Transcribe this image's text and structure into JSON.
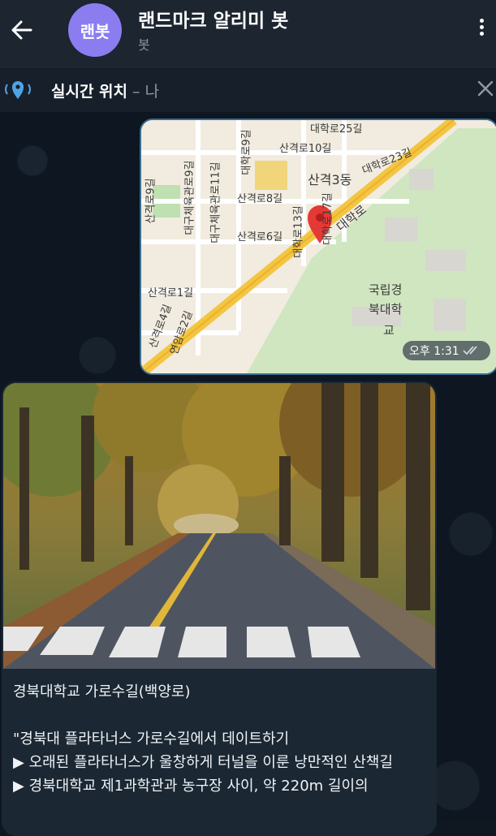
{
  "header": {
    "avatar_text": "랜봇",
    "title": "랜드마크 알리미 봇",
    "subtitle": "봇"
  },
  "live_location": {
    "label": "실시간 위치",
    "who": " – 나"
  },
  "map_message": {
    "time": "오후 1:31",
    "labels": [
      "대학로25길",
      "산격로10길",
      "산격3동",
      "대학로23길",
      "산격로9길",
      "대구체육관로9길",
      "대구체육관로11길",
      "산격로8길",
      "대학로9길",
      "산격로6길",
      "대학로13길",
      "대학로17길",
      "대학로",
      "산격로1길",
      "국립경",
      "북대학",
      "교",
      "연암로2길",
      "산격로4길"
    ]
  },
  "photo_message": {
    "caption_lines": [
      "경북대학교 가로수길(백양로)",
      "",
      " \"경북대 플라타너스 가로수길에서 데이트하기",
      "▶ 오래된 플라타너스가 울창하게 터널을 이룬 낭만적인 산책길",
      "▶ 경북대학교 제1과학관과 농구장 사이, 약 220m 길이의"
    ]
  },
  "colors": {
    "accent": "#8b7cf0",
    "topbar": "#1c2530",
    "chat_bg": "#0e1621",
    "bubble": "#1b2733",
    "map_road": "#f4c542"
  }
}
